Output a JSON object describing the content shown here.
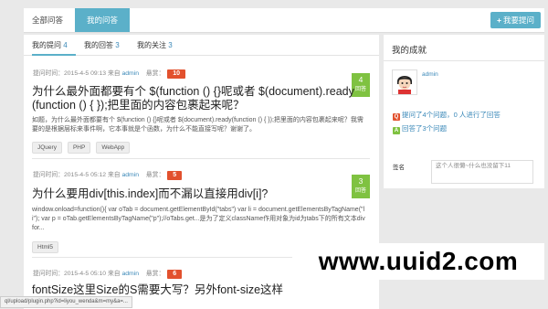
{
  "top_tabs": [
    "全部问答",
    "我的问答"
  ],
  "ask_button": "我要提问",
  "subtabs": [
    {
      "label": "我的提问",
      "count": "4"
    },
    {
      "label": "我的回答",
      "count": "3"
    },
    {
      "label": "我的关注",
      "count": "3"
    }
  ],
  "questions": [
    {
      "meta_prefix": "提问时间：2015-4-5 09:13 来自",
      "author": "admin",
      "bounty_label": "悬赏：",
      "bounty": "10",
      "answers_count": "4",
      "answers_label": "回答",
      "title": "为什么最外面都要有个 $(function () {}呢或者 $(document).ready(function () { });把里面的内容包裹起来呢？",
      "excerpt": "如题，为什么最外面都要有个 $(function () {}呢或者 $(document).ready(function () { });把里面的内容包裹起来呢？我需要的是根据层标来事件啊，它本事就是个函数，为什么不能直接写呢？谢谢了。",
      "tags": [
        "JQuery",
        "PHP",
        "WebApp"
      ]
    },
    {
      "meta_prefix": "提问时间：2015-4-5 05:12 来自",
      "author": "admin",
      "bounty_label": "悬赏：",
      "bounty": "5",
      "answers_count": "3",
      "answers_label": "回答",
      "title": "为什么要用div[this.index]而不漏以直接用div[i]?",
      "excerpt": "window.onload=function(){ var oTab = document.getElementById(\"tabs\") var li = document.getElementsByTagName(\"li\"); var p = oTab.getElementsByTagName(\"p\");//oTabs.get...是为了定义className作用对象为id为tabs下的所有文本div for...",
      "tags": [
        "Html5"
      ]
    },
    {
      "meta_prefix": "提问时间：2015-4-5 05:10 来自",
      "author": "admin",
      "bounty_label": "悬赏：",
      "bounty": "6",
      "title": "fontSize这里Size的S需要大写？另外font-size这样"
    }
  ],
  "sidebar": {
    "title": "我的成就",
    "username": "admin",
    "stat1": "提问了4个问题，0 人进行了回答",
    "stat2": "回答了3个问题",
    "signature_label": "签名",
    "signature_text": "这个人很懒~什么也没留下11"
  },
  "statusbar": "ql/upload/plugin.php?id=liyou_wenda&m=my&a=...",
  "watermark": "www.uuid2.com",
  "colors": {
    "accent": "#5bb0c9",
    "bounty": "#e2512e",
    "answers": "#7fc241",
    "link": "#3a88b8"
  }
}
